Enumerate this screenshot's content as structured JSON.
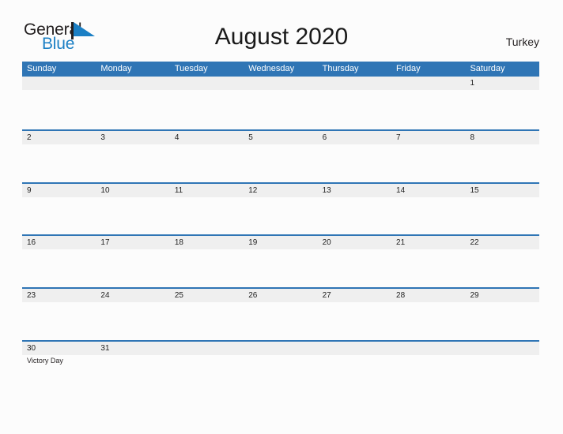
{
  "brand": {
    "word_one": "General",
    "word_two": "Blue",
    "flag_icon": "blue-triangle-flag-icon",
    "dark_color": "#231f20",
    "blue_color": "#1b7fc4"
  },
  "header": {
    "title": "August 2020",
    "region": "Turkey"
  },
  "calendar": {
    "accent_color": "#2f75b5",
    "band_color": "#efefef",
    "weekdays": [
      "Sunday",
      "Monday",
      "Tuesday",
      "Wednesday",
      "Thursday",
      "Friday",
      "Saturday"
    ],
    "weeks": [
      {
        "days": [
          {
            "num": "",
            "event": ""
          },
          {
            "num": "",
            "event": ""
          },
          {
            "num": "",
            "event": ""
          },
          {
            "num": "",
            "event": ""
          },
          {
            "num": "",
            "event": ""
          },
          {
            "num": "",
            "event": ""
          },
          {
            "num": "1",
            "event": ""
          }
        ]
      },
      {
        "days": [
          {
            "num": "2",
            "event": ""
          },
          {
            "num": "3",
            "event": ""
          },
          {
            "num": "4",
            "event": ""
          },
          {
            "num": "5",
            "event": ""
          },
          {
            "num": "6",
            "event": ""
          },
          {
            "num": "7",
            "event": ""
          },
          {
            "num": "8",
            "event": ""
          }
        ]
      },
      {
        "days": [
          {
            "num": "9",
            "event": ""
          },
          {
            "num": "10",
            "event": ""
          },
          {
            "num": "11",
            "event": ""
          },
          {
            "num": "12",
            "event": ""
          },
          {
            "num": "13",
            "event": ""
          },
          {
            "num": "14",
            "event": ""
          },
          {
            "num": "15",
            "event": ""
          }
        ]
      },
      {
        "days": [
          {
            "num": "16",
            "event": ""
          },
          {
            "num": "17",
            "event": ""
          },
          {
            "num": "18",
            "event": ""
          },
          {
            "num": "19",
            "event": ""
          },
          {
            "num": "20",
            "event": ""
          },
          {
            "num": "21",
            "event": ""
          },
          {
            "num": "22",
            "event": ""
          }
        ]
      },
      {
        "days": [
          {
            "num": "23",
            "event": ""
          },
          {
            "num": "24",
            "event": ""
          },
          {
            "num": "25",
            "event": ""
          },
          {
            "num": "26",
            "event": ""
          },
          {
            "num": "27",
            "event": ""
          },
          {
            "num": "28",
            "event": ""
          },
          {
            "num": "29",
            "event": ""
          }
        ]
      },
      {
        "days": [
          {
            "num": "30",
            "event": "Victory Day"
          },
          {
            "num": "31",
            "event": ""
          },
          {
            "num": "",
            "event": ""
          },
          {
            "num": "",
            "event": ""
          },
          {
            "num": "",
            "event": ""
          },
          {
            "num": "",
            "event": ""
          },
          {
            "num": "",
            "event": ""
          }
        ]
      }
    ]
  }
}
